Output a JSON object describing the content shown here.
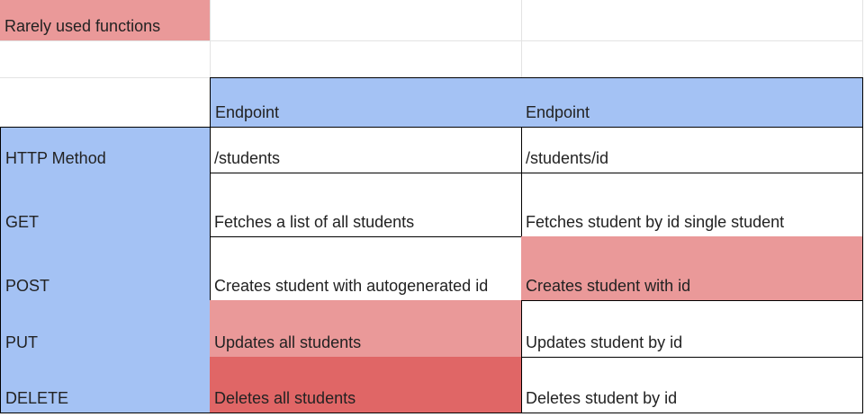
{
  "legend": {
    "rarely_used_label": "Rarely used functions"
  },
  "table": {
    "header_row": {
      "corner": "",
      "col1": "Endpoint",
      "col2": "Endpoint"
    },
    "rows": [
      {
        "label": "HTTP Method",
        "col1": "/students",
        "col2": "/students/id"
      },
      {
        "label": "GET",
        "col1": "Fetches a list of all students",
        "col2": "Fetches student by id single student"
      },
      {
        "label": "POST",
        "col1": "Creates student with autogenerated id",
        "col2": "Creates student with id"
      },
      {
        "label": "PUT",
        "col1": "Updates all students",
        "col2": "Updates student by id"
      },
      {
        "label": "DELETE",
        "col1": "Deletes all students",
        "col2": "Deletes student by id"
      }
    ]
  },
  "colors": {
    "header_blue": "#a4c2f4",
    "rarely_used": "#ea9999",
    "dangerous": "#e06666"
  }
}
